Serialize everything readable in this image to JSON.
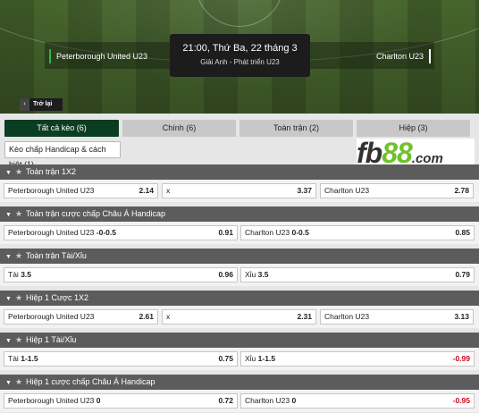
{
  "match": {
    "time": "21:00, Thứ Ba, 22 tháng 3",
    "league": "Giải Anh - Phát triển U23",
    "home": "Peterborough United U23",
    "away": "Charlton U23"
  },
  "back_label": "Trở lại",
  "tabs": [
    {
      "label": "Tất cả kèo (6)",
      "active": true
    },
    {
      "label": "Chính (6)"
    },
    {
      "label": "Toàn trận (2)"
    },
    {
      "label": "Hiệp (3)"
    },
    {
      "label": "Kèo chấp Handicap & cách biệt (1)"
    }
  ],
  "logo": {
    "fb": "fb",
    "n88": "88",
    "com": ".com"
  },
  "sections": [
    {
      "title": "Toàn trận 1X2",
      "cells": [
        {
          "label": "Peterborough United U23",
          "line": "",
          "odd": "2.14"
        },
        {
          "label": "x",
          "line": "",
          "odd": "3.37"
        },
        {
          "label": "Charlton U23",
          "line": "",
          "odd": "2.78"
        }
      ]
    },
    {
      "title": "Toàn trận cược chấp Châu Á Handicap",
      "cells": [
        {
          "label": "Peterborough United U23",
          "line": "-0-0.5",
          "odd": "0.91"
        },
        {
          "label": "Charlton U23",
          "line": "0-0.5",
          "odd": "0.85"
        }
      ]
    },
    {
      "title": "Toàn trận Tài/Xỉu",
      "cells": [
        {
          "label": "Tài",
          "line": "3.5",
          "odd": "0.96"
        },
        {
          "label": "Xỉu",
          "line": "3.5",
          "odd": "0.79"
        }
      ]
    },
    {
      "title": "Hiệp 1 Cược 1X2",
      "cells": [
        {
          "label": "Peterborough United U23",
          "line": "",
          "odd": "2.61"
        },
        {
          "label": "x",
          "line": "",
          "odd": "2.31"
        },
        {
          "label": "Charlton U23",
          "line": "",
          "odd": "3.13"
        }
      ]
    },
    {
      "title": "Hiệp 1 Tài/Xỉu",
      "cells": [
        {
          "label": "Tài",
          "line": "1-1.5",
          "odd": "0.75"
        },
        {
          "label": "Xỉu",
          "line": "1-1.5",
          "odd": "-0.99"
        }
      ]
    },
    {
      "title": "Hiệp 1 cược chấp Châu Á Handicap",
      "cells": [
        {
          "label": "Peterborough United U23",
          "line": "0",
          "odd": "0.72"
        },
        {
          "label": "Charlton U23",
          "line": "0",
          "odd": "-0.95"
        }
      ]
    }
  ]
}
